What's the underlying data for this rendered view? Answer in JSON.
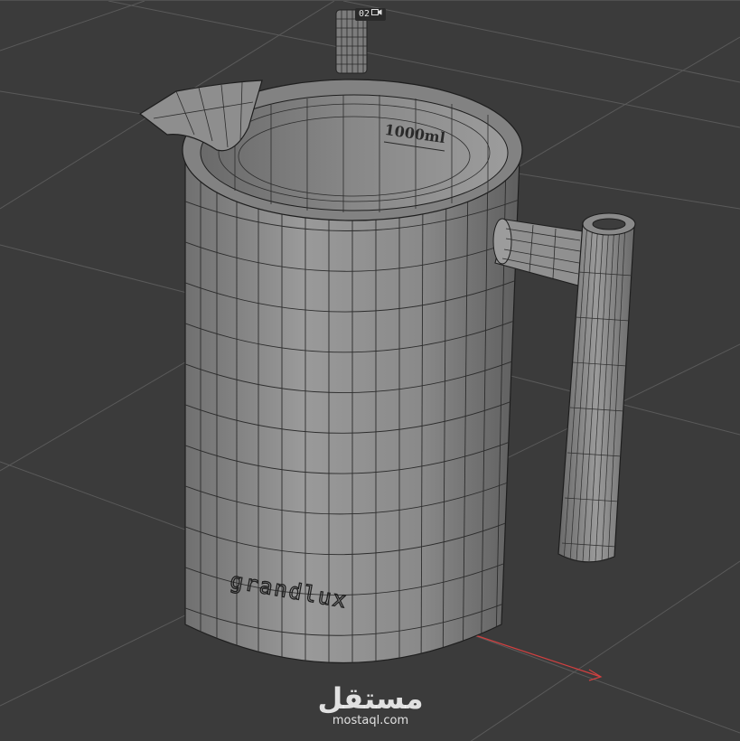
{
  "viewport": {
    "camera_label": "02",
    "camera_icon": "camera-icon",
    "background_color": "#3b3b3b",
    "grid_color": "#5a5a5a",
    "axis_x_color": "#d04040"
  },
  "model": {
    "object": "pitcher",
    "capacity_label": "1000ml",
    "brand_label": "grandlux",
    "shading": "wireframe-on-shaded",
    "body_color": "#8a8a8a"
  },
  "watermark": {
    "arabic_text": "مستقل",
    "url": "mostaql.com"
  }
}
